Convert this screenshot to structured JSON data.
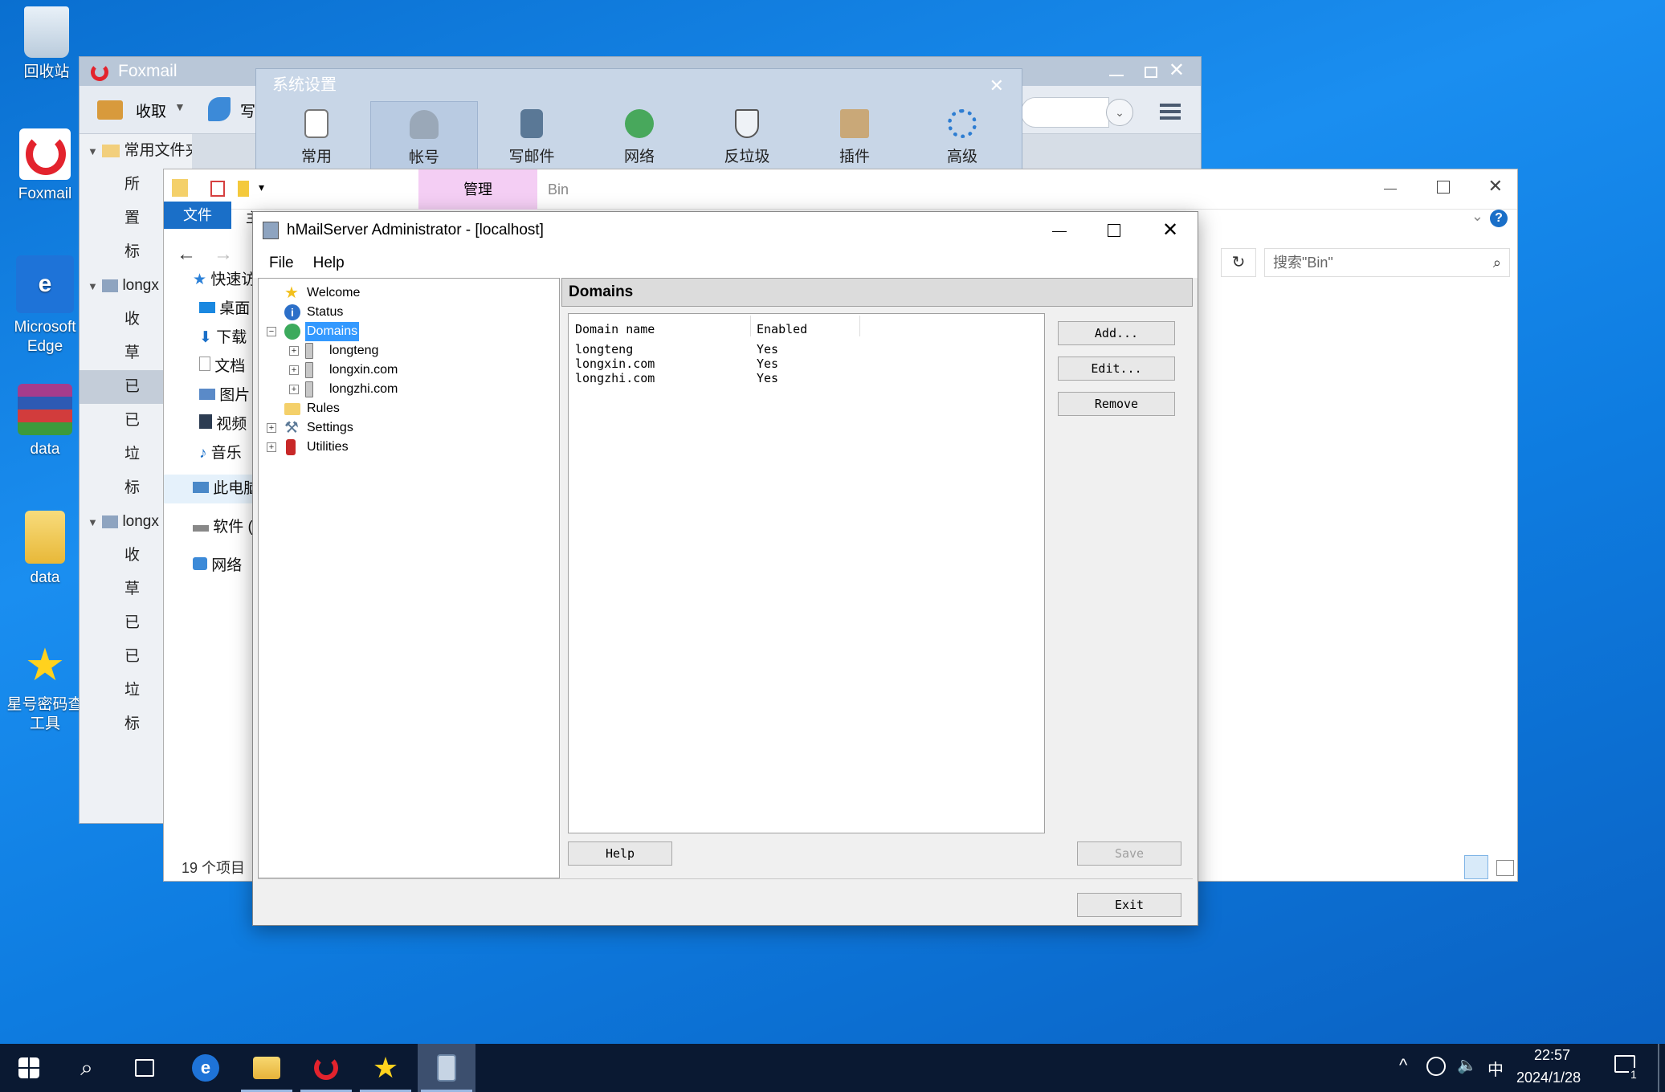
{
  "desktop": {
    "icons": [
      {
        "label": "回收站",
        "icon": "recycle-bin-icon"
      },
      {
        "label": "Foxmail",
        "icon": "foxmail-icon"
      },
      {
        "label": "Microsoft Edge",
        "icon": "edge-icon"
      },
      {
        "label": "data",
        "icon": "winrar-icon"
      },
      {
        "label": "data",
        "icon": "folder-icon"
      },
      {
        "label": "星号密码查工具",
        "icon": "star-icon"
      }
    ]
  },
  "foxmail": {
    "title": "Foxmail",
    "receive": "收取",
    "write": "写",
    "folders": [
      {
        "label": "常用文件夹",
        "group": true
      },
      {
        "label": "所",
        "group": false
      },
      {
        "label": "置",
        "group": false
      },
      {
        "label": "标",
        "group": false
      },
      {
        "label": "longx",
        "group": true
      },
      {
        "label": "收",
        "group": false
      },
      {
        "label": "草",
        "group": false
      },
      {
        "label": "已",
        "group": false,
        "selected": true
      },
      {
        "label": "已",
        "group": false
      },
      {
        "label": "垃",
        "group": false
      },
      {
        "label": "标",
        "group": false
      },
      {
        "label": "longx",
        "group": true
      },
      {
        "label": "收",
        "group": false
      },
      {
        "label": "草",
        "group": false
      },
      {
        "label": "已",
        "group": false
      },
      {
        "label": "已",
        "group": false
      },
      {
        "label": "垃",
        "group": false
      },
      {
        "label": "标",
        "group": false
      }
    ]
  },
  "sys_settings": {
    "title": "系统设置",
    "tabs": [
      {
        "label": "常用",
        "icon": "phone-icon"
      },
      {
        "label": "帐号",
        "icon": "user-icon",
        "active": true
      },
      {
        "label": "写邮件",
        "icon": "pen-icon"
      },
      {
        "label": "网络",
        "icon": "globe-icon"
      },
      {
        "label": "反垃圾",
        "icon": "shield-icon"
      },
      {
        "label": "插件",
        "icon": "box-icon"
      },
      {
        "label": "高级",
        "icon": "gear-icon"
      }
    ]
  },
  "explorer": {
    "manage_tab": "管理",
    "folder_title": "Bin",
    "file_tab": "文件",
    "home_tab_fragment": "主",
    "search_placeholder": "搜索\"Bin\"",
    "nav": [
      {
        "label": "快速访",
        "icon": "star-blue-icon"
      },
      {
        "label": "桌面",
        "icon": "desktop-icon"
      },
      {
        "label": "下载",
        "icon": "download-icon"
      },
      {
        "label": "文档",
        "icon": "document-icon"
      },
      {
        "label": "图片",
        "icon": "pictures-icon"
      },
      {
        "label": "视频",
        "icon": "video-icon"
      },
      {
        "label": "音乐",
        "icon": "music-icon"
      },
      {
        "label": "此电脑",
        "icon": "computer-icon"
      },
      {
        "label": "软件 (",
        "icon": "drive-icon"
      },
      {
        "label": "网络",
        "icon": "network-icon"
      }
    ],
    "status": "19 个项目"
  },
  "hmail": {
    "title": "hMailServer Administrator - [localhost]",
    "menu": [
      "File",
      "Help"
    ],
    "tree": [
      {
        "label": "Welcome",
        "level": 1,
        "icon": "star-icon",
        "exp": ""
      },
      {
        "label": "Status",
        "level": 1,
        "icon": "info-icon",
        "exp": ""
      },
      {
        "label": "Domains",
        "level": 1,
        "icon": "globe-icon",
        "exp": "−",
        "selected": true
      },
      {
        "label": "longteng",
        "level": 2,
        "icon": "server-icon",
        "exp": "+"
      },
      {
        "label": "longxin.com",
        "level": 2,
        "icon": "server-icon",
        "exp": "+"
      },
      {
        "label": "longzhi.com",
        "level": 2,
        "icon": "server-icon",
        "exp": "+"
      },
      {
        "label": "Rules",
        "level": 1,
        "icon": "folder-icon",
        "exp": ""
      },
      {
        "label": "Settings",
        "level": 1,
        "icon": "tools-icon",
        "exp": "+"
      },
      {
        "label": "Utilities",
        "level": 1,
        "icon": "utilities-icon",
        "exp": "+"
      }
    ],
    "panel_title": "Domains",
    "columns": [
      "Domain name",
      "Enabled"
    ],
    "rows": [
      [
        "longteng",
        "Yes"
      ],
      [
        "longxin.com",
        "Yes"
      ],
      [
        "longzhi.com",
        "Yes"
      ]
    ],
    "buttons": {
      "add": "Add...",
      "edit": "Edit...",
      "remove": "Remove",
      "help": "Help",
      "save": "Save",
      "exit": "Exit"
    }
  },
  "taskbar": {
    "ime": "中",
    "time": "22:57",
    "date": "2024/1/28",
    "notifications": "1"
  }
}
